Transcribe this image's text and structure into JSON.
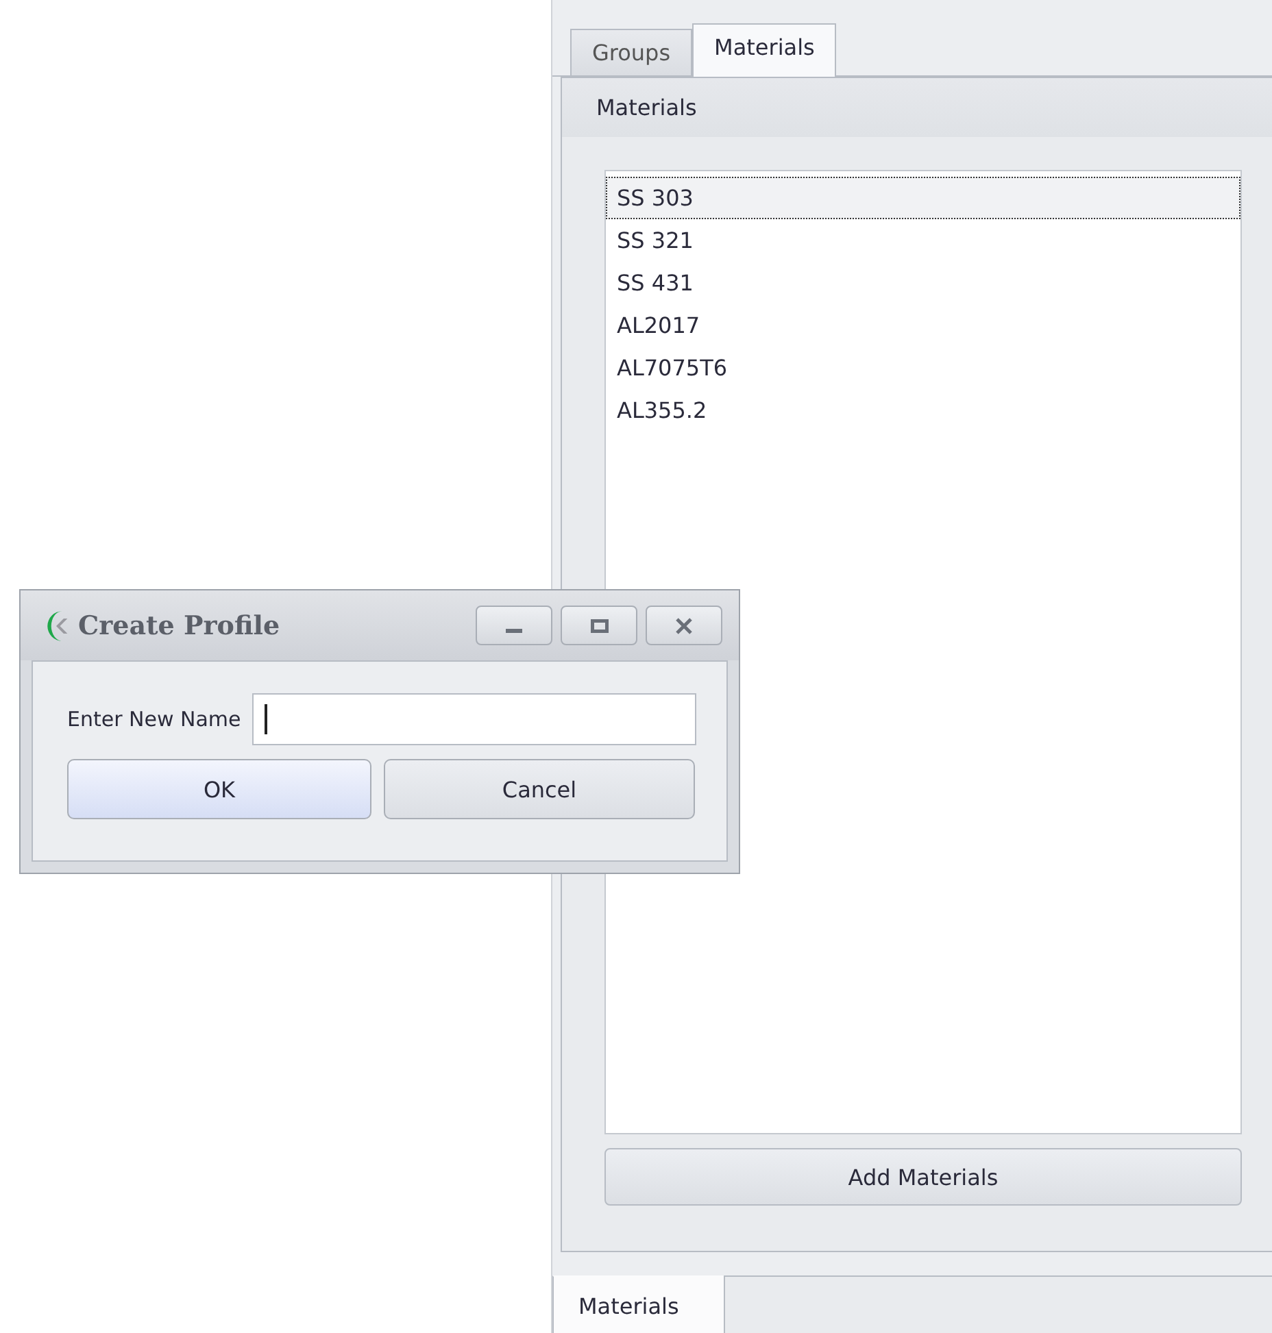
{
  "panel": {
    "tabs": [
      {
        "label": "Groups",
        "selected": false
      },
      {
        "label": "Materials",
        "selected": true
      }
    ],
    "group": {
      "title": "Materials",
      "items": [
        {
          "label": "SS 303",
          "selected": true
        },
        {
          "label": "SS 321",
          "selected": false
        },
        {
          "label": "SS 431",
          "selected": false
        },
        {
          "label": "AL2017",
          "selected": false
        },
        {
          "label": "AL7075T6",
          "selected": false
        },
        {
          "label": "AL355.2",
          "selected": false
        }
      ],
      "button": "Add Materials"
    }
  },
  "bottom_tabs": [
    {
      "label": "Materials",
      "selected": true
    }
  ],
  "dialog": {
    "title": "Create Profile",
    "field": {
      "label": "Enter New Name",
      "focused": true
    },
    "buttons": [
      {
        "label": "OK",
        "default": true
      },
      {
        "label": "Cancel",
        "default": false
      }
    ]
  }
}
